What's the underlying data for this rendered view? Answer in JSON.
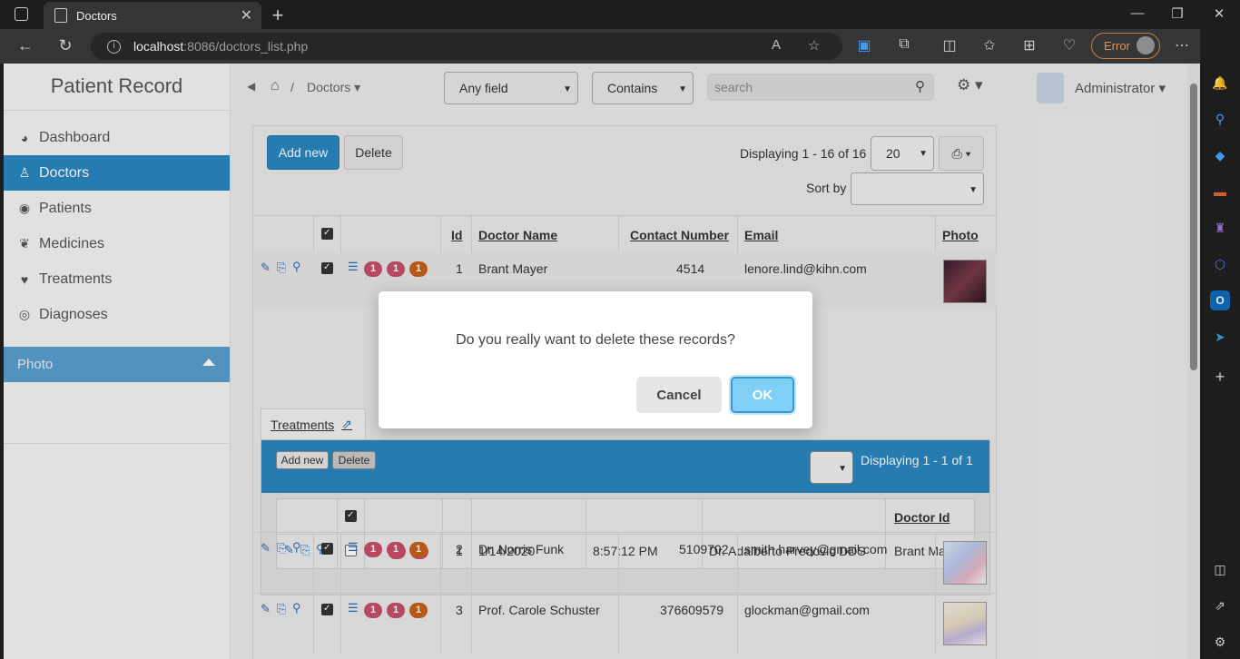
{
  "browser": {
    "tab_title": "Doctors",
    "url_host": "localhost",
    "url_path": ":8086/doctors_list.php",
    "error_label": "Error"
  },
  "sidebar": {
    "brand": "Patient Record",
    "items": [
      {
        "label": "Dashboard",
        "icon": "dashboard-icon"
      },
      {
        "label": "Doctors",
        "icon": "user-md-icon"
      },
      {
        "label": "Patients",
        "icon": "user-circle-icon"
      },
      {
        "label": "Medicines",
        "icon": "leaf-icon"
      },
      {
        "label": "Treatments",
        "icon": "heart-icon"
      },
      {
        "label": "Diagnoses",
        "icon": "eye-icon"
      }
    ],
    "photo_label": "Photo"
  },
  "topbar": {
    "breadcrumb_current": "Doctors",
    "field_select": "Any field",
    "operator_select": "Contains",
    "search_placeholder": "search",
    "user_name": "Administrator"
  },
  "toolbar": {
    "add_new": "Add new",
    "delete": "Delete",
    "displaying": "Displaying 1 - 16 of 16",
    "page_size": "20",
    "sort_by_label": "Sort by"
  },
  "grid": {
    "headers": [
      "Id",
      "Doctor Name",
      "Contact Number",
      "Email",
      "Photo"
    ],
    "rows": [
      {
        "id": "1",
        "name": "Brant Mayer",
        "contact": "4514",
        "email": "lenore.lind@kihn.com"
      },
      {
        "id": "2",
        "name": "Dr. Norris Funk",
        "contact": "5109702",
        "email": "smith.harvey@gmail.com"
      },
      {
        "id": "3",
        "name": "Prof. Carole Schuster",
        "contact": "376609579",
        "email": "glockman@gmail.com"
      }
    ],
    "badges": [
      "1",
      "1",
      "1"
    ]
  },
  "detail": {
    "tab_label": "Treatments",
    "add_new": "Add new",
    "delete": "Delete",
    "displaying": "Displaying 1 - 1 of 1",
    "last_header": "Doctor Id",
    "row": {
      "id": "1",
      "date": "1/14/2020",
      "time": "8:57:12 PM",
      "patient": "Dr. Adalberto Predovic DDS",
      "doctor": "Brant Mayer"
    },
    "badges": [
      "1",
      "1"
    ]
  },
  "modal": {
    "message": "Do you really want to delete these records?",
    "cancel": "Cancel",
    "ok": "OK"
  }
}
